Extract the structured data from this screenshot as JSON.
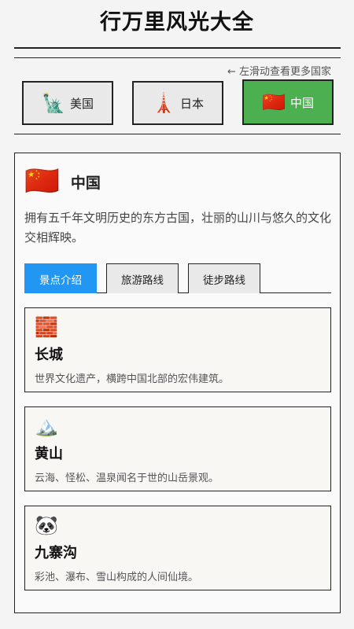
{
  "app_title": "行万里风光大全",
  "swipe_hint": "← 左滑动查看更多国家",
  "countries": [
    {
      "flag": "🗽",
      "label": "美国"
    },
    {
      "flag": "🗼",
      "label": "日本"
    },
    {
      "flag": "🇨🇳",
      "label": "中国"
    }
  ],
  "selected": {
    "flag": "🇨🇳",
    "name": "中国",
    "description": "拥有五千年文明历史的东方古国，壮丽的山川与悠久的文化交相辉映。"
  },
  "tabs": [
    "景点介绍",
    "旅游路线",
    "徒步路线"
  ],
  "spots": [
    {
      "icon": "🧱",
      "title": "长城",
      "desc": "世界文化遗产，横跨中国北部的宏伟建筑。"
    },
    {
      "icon": "🏔️",
      "title": "黄山",
      "desc": "云海、怪松、温泉闻名于世的山岳景观。"
    },
    {
      "icon": "🐼",
      "title": "九寨沟",
      "desc": "彩池、瀑布、雪山构成的人间仙境。"
    }
  ],
  "colors": {
    "active_country": "#4caf50",
    "active_tab": "#2196f3"
  }
}
